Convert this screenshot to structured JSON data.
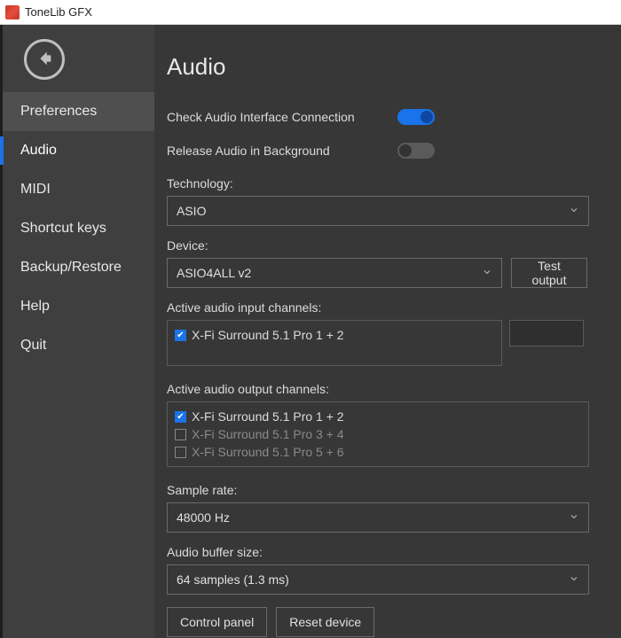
{
  "window": {
    "title": "ToneLib GFX"
  },
  "sidebar": {
    "items": [
      {
        "label": "Preferences"
      },
      {
        "label": "Audio"
      },
      {
        "label": "MIDI"
      },
      {
        "label": "Shortcut keys"
      },
      {
        "label": "Backup/Restore"
      },
      {
        "label": "Help"
      },
      {
        "label": "Quit"
      }
    ]
  },
  "page": {
    "title": "Audio",
    "check_connection_label": "Check Audio Interface Connection",
    "check_connection_on": true,
    "release_bg_label": "Release Audio in Background",
    "release_bg_on": false,
    "technology_label": "Technology:",
    "technology_value": "ASIO",
    "device_label": "Device:",
    "device_value": "ASIO4ALL v2",
    "test_output_label": "Test output",
    "input_channels_label": "Active audio input channels:",
    "input_channels": [
      {
        "label": "X-Fi Surround 5.1 Pro 1 + 2",
        "checked": true,
        "disabled": false
      }
    ],
    "output_channels_label": "Active audio output channels:",
    "output_channels": [
      {
        "label": "X-Fi Surround 5.1 Pro 1 + 2",
        "checked": true,
        "disabled": false
      },
      {
        "label": "X-Fi Surround 5.1 Pro 3 + 4",
        "checked": false,
        "disabled": true
      },
      {
        "label": "X-Fi Surround 5.1 Pro 5 + 6",
        "checked": false,
        "disabled": true
      }
    ],
    "sample_rate_label": "Sample rate:",
    "sample_rate_value": "48000 Hz",
    "buffer_label": "Audio buffer size:",
    "buffer_value": "64 samples (1.3 ms)",
    "control_panel_label": "Control panel",
    "reset_device_label": "Reset device"
  }
}
